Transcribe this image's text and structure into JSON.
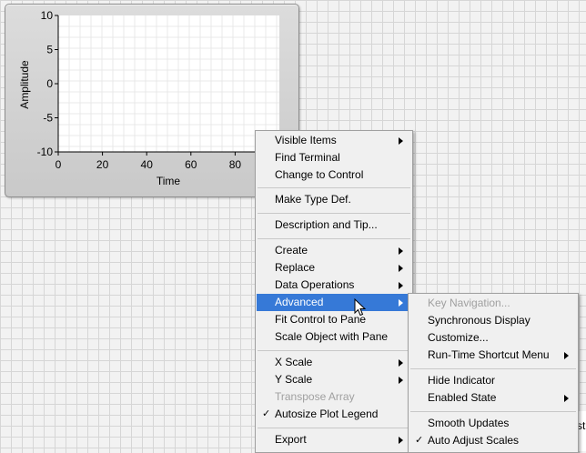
{
  "graph": {
    "ylabel": "Amplitude",
    "xlabel": "Time",
    "y_ticks": [
      "10",
      "5",
      "0",
      "-5",
      "-10"
    ],
    "x_ticks": [
      "0",
      "20",
      "40",
      "60",
      "80"
    ]
  },
  "main_menu": {
    "items": [
      {
        "label": "Visible Items",
        "submenu": true
      },
      {
        "label": "Find Terminal"
      },
      {
        "label": "Change to Control"
      },
      {
        "label": "Make Type Def."
      },
      {
        "label": "Description and Tip..."
      },
      {
        "label": "Create",
        "submenu": true
      },
      {
        "label": "Replace",
        "submenu": true
      },
      {
        "label": "Data Operations",
        "submenu": true
      },
      {
        "label": "Advanced",
        "submenu": true,
        "highlighted": true
      },
      {
        "label": "Fit Control to Pane"
      },
      {
        "label": "Scale Object with Pane"
      },
      {
        "label": "X Scale",
        "submenu": true
      },
      {
        "label": "Y Scale",
        "submenu": true
      },
      {
        "label": "Transpose Array",
        "disabled": true
      },
      {
        "label": "Autosize Plot Legend",
        "checked": true
      },
      {
        "label": "Export",
        "submenu": true
      }
    ]
  },
  "sub_menu": {
    "items": [
      {
        "label": "Key Navigation...",
        "disabled": true
      },
      {
        "label": "Synchronous Display"
      },
      {
        "label": "Customize..."
      },
      {
        "label": "Run-Time Shortcut Menu",
        "submenu": true
      },
      {
        "label": "Hide Indicator"
      },
      {
        "label": "Enabled State",
        "submenu": true
      },
      {
        "label": "Smooth Updates"
      },
      {
        "label": "Auto Adjust Scales",
        "checked": true
      }
    ]
  },
  "check_glyph": "✓",
  "bottom_text": "st"
}
